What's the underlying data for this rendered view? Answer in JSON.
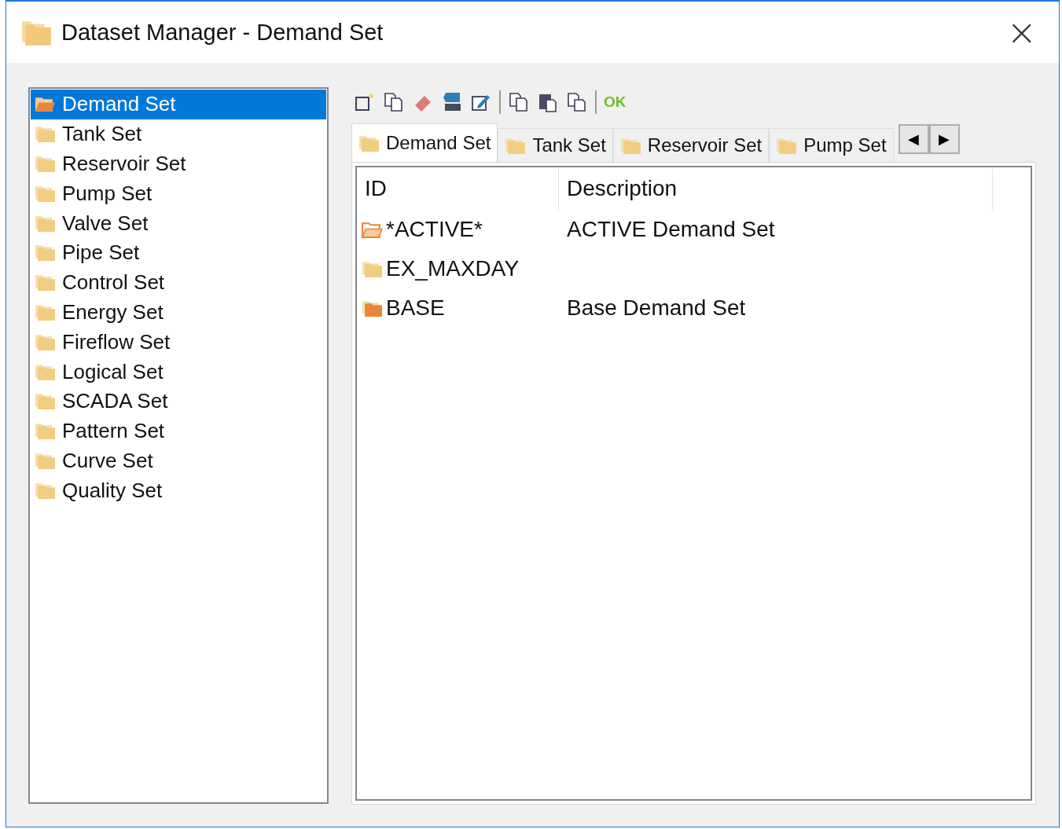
{
  "window": {
    "title": "Dataset Manager - Demand Set",
    "close": "×"
  },
  "sidebar": {
    "items": [
      {
        "label": "Demand Set",
        "selected": true
      },
      {
        "label": "Tank Set",
        "selected": false
      },
      {
        "label": "Reservoir Set",
        "selected": false
      },
      {
        "label": "Pump Set",
        "selected": false
      },
      {
        "label": "Valve Set",
        "selected": false
      },
      {
        "label": "Pipe Set",
        "selected": false
      },
      {
        "label": "Control Set",
        "selected": false
      },
      {
        "label": "Energy Set",
        "selected": false
      },
      {
        "label": "Fireflow Set",
        "selected": false
      },
      {
        "label": "Logical Set",
        "selected": false
      },
      {
        "label": "SCADA Set",
        "selected": false
      },
      {
        "label": "Pattern Set",
        "selected": false
      },
      {
        "label": "Curve Set",
        "selected": false
      },
      {
        "label": "Quality Set",
        "selected": false
      }
    ]
  },
  "toolbar": [
    {
      "kind": "new"
    },
    {
      "kind": "copy"
    },
    {
      "kind": "erase"
    },
    {
      "kind": "id"
    },
    {
      "kind": "edit"
    },
    {
      "kind": "separator"
    },
    {
      "kind": "copy"
    },
    {
      "kind": "paste"
    },
    {
      "kind": "duplicate"
    },
    {
      "kind": "separator"
    },
    {
      "kind": "text",
      "label": "OK"
    }
  ],
  "tabs": [
    {
      "label": "Demand Set",
      "selected": true
    },
    {
      "label": "Tank Set",
      "selected": false
    },
    {
      "label": "Reservoir Set",
      "selected": false
    },
    {
      "label": "Pump Set",
      "selected": false
    }
  ],
  "tab_scroll": [
    "◀",
    "▶"
  ],
  "table": {
    "columns": [
      "ID",
      "Description"
    ],
    "rows": [
      {
        "kind": "open",
        "id": "*ACTIVE*",
        "description": "ACTIVE Demand Set"
      },
      {
        "kind": "plain",
        "id": "EX_MAXDAY"
      },
      {
        "kind": "filled",
        "id": "BASE",
        "description": "Base Demand Set"
      }
    ]
  }
}
